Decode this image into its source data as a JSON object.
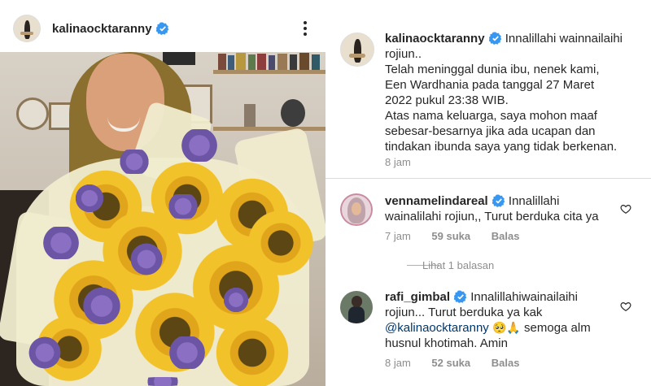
{
  "post": {
    "username": "kalinaocktaranny",
    "verified": true
  },
  "caption": {
    "username": "kalinaocktaranny",
    "line1": "Innalillahi wainnailaihi",
    "line2": "rojiun..",
    "line3": "Telah meninggal dunia ibu, nenek kami,",
    "line4": "Een Wardhania pada tanggal 27 Maret",
    "line5": "2022 pukul 23:38 WIB.",
    "line6": "Atas nama keluarga, saya mohon maaf",
    "line7": "sebesar-besarnya jika ada ucapan dan",
    "line8": "tindakan ibunda saya yang tidak berkenan.",
    "time": "8 jam"
  },
  "comments": [
    {
      "username": "vennamelindareal",
      "line1": "Innalillahi",
      "line2": "wainalilahi rojiun,, Turut berduka cita ya",
      "time": "7 jam",
      "likes": "59 suka",
      "reply": "Balas",
      "view_replies": "Lihat 1 balasan"
    },
    {
      "username": "rafi_gimbal",
      "line1": "Innalillahiwainailaihi",
      "line2": "rojiun... Turut berduka ya kak",
      "mention": "@kalinaocktaranny",
      "emoji": "🥺🙏",
      "line3_tail": "semoga alm",
      "line4": "husnul khotimah. Amin",
      "time": "8 jam",
      "likes": "52 suka",
      "reply": "Balas"
    }
  ],
  "colors": {
    "verified": "#3897f0",
    "text": "#262626",
    "meta": "#8e8e8e",
    "mention": "#00376b"
  },
  "icons": {
    "verified": "verified-badge-icon",
    "more": "more-options-icon",
    "like": "heart-icon"
  }
}
